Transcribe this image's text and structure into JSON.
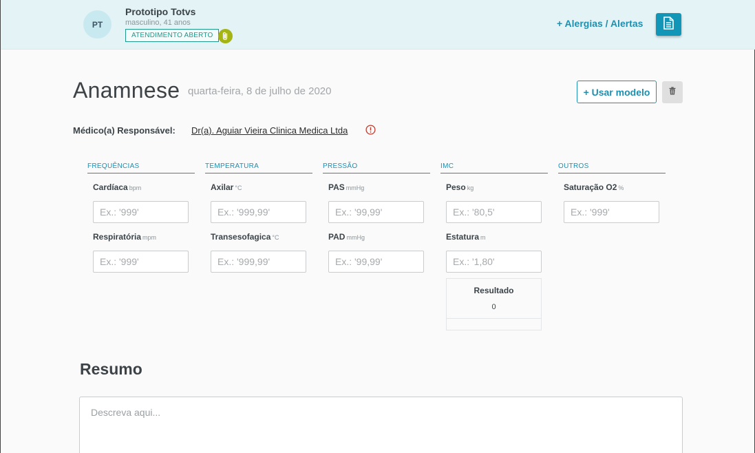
{
  "patient": {
    "initials": "PT",
    "name": "Prototipo Totvs",
    "details": "masculino, 41 anos",
    "status": "ATENDIMENTO ABERTO",
    "alerts_link": "+ Alergias / Alertas"
  },
  "page": {
    "title": "Anamnese",
    "date": "quarta-feira, 8 de julho de 2020",
    "use_model_label": "+ Usar modelo"
  },
  "doctor": {
    "label": "Médico(a) Responsável:",
    "name": "Dr(a). Aguiar Vieira Clinica Medica Ltda"
  },
  "vitals": {
    "frequencias": {
      "header": "FREQUÊNCIAS",
      "cardiaca": {
        "label": "Cardíaca",
        "unit": "bpm",
        "placeholder": "Ex.: '999'",
        "value": ""
      },
      "respiratoria": {
        "label": "Respiratória",
        "unit": "mpm",
        "placeholder": "Ex.: '999'",
        "value": ""
      }
    },
    "temperatura": {
      "header": "TEMPERATURA",
      "axilar": {
        "label": "Axilar",
        "unit": "°C",
        "placeholder": "Ex.: '999,99'",
        "value": ""
      },
      "transesofagica": {
        "label": "Transesofagica",
        "unit": "°C",
        "placeholder": "Ex.: '999,99'",
        "value": ""
      }
    },
    "pressao": {
      "header": "PRESSÃO",
      "pas": {
        "label": "PAS",
        "unit": "mmHg",
        "placeholder": "Ex.: '99,99'",
        "value": ""
      },
      "pad": {
        "label": "PAD",
        "unit": "mmHg",
        "placeholder": "Ex.: '99,99'",
        "value": ""
      }
    },
    "imc": {
      "header": "IMC",
      "peso": {
        "label": "Peso",
        "unit": "kg",
        "placeholder": "Ex.: '80,5'",
        "value": ""
      },
      "estatura": {
        "label": "Estatura",
        "unit": "m",
        "placeholder": "Ex.: '1,80'",
        "value": ""
      },
      "resultado_label": "Resultado",
      "resultado_value": "0"
    },
    "outros": {
      "header": "OUTROS",
      "saturacao": {
        "label": "Saturação O2",
        "unit": "%",
        "placeholder": "Ex.: '999'",
        "value": ""
      }
    }
  },
  "resumo": {
    "title": "Resumo",
    "placeholder": "Descreva aqui..."
  },
  "colors": {
    "accent": "#1d8fb0",
    "header_bg": "#e3f3f6",
    "status_green": "#1d9a8c",
    "clip_badge": "#a4b413",
    "info_red": "#c0392b"
  }
}
